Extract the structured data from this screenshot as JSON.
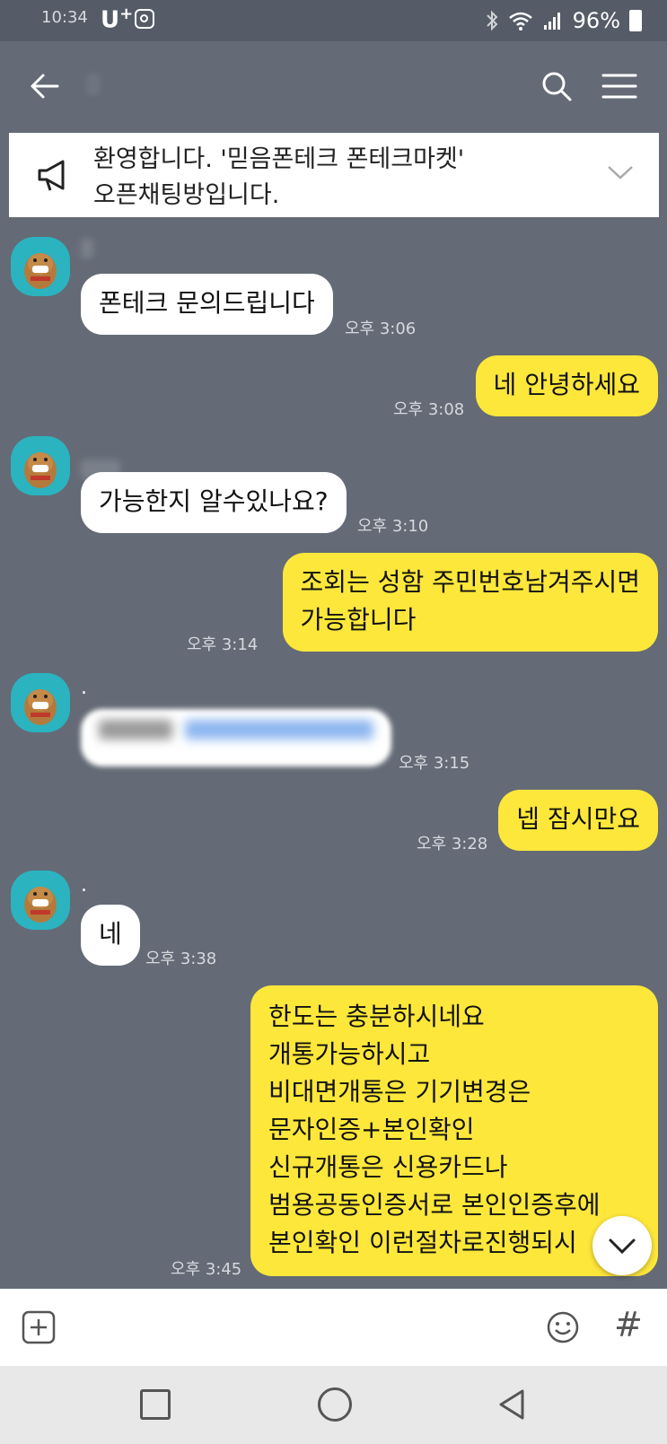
{
  "status_bar": {
    "time": "10:34",
    "carrier": "U",
    "carrier_sup": "+",
    "battery": "96%"
  },
  "notice": {
    "line1": "환영합니다. '믿음폰테크 폰테크마켓'",
    "line2": "오픈채팅방입니다."
  },
  "messages": [
    {
      "sender_visible": ".",
      "text": "폰테크 문의드립니다",
      "time": "오후 3:06"
    },
    {
      "text": "네 안녕하세요",
      "time": "오후 3:08"
    },
    {
      "text": "가능한지 알수있나요?",
      "time": "오후 3:10"
    },
    {
      "lines": [
        "조회는 성함 주민번호남겨주시면",
        "가능합니다"
      ],
      "time": "오후 3:14"
    },
    {
      "sender_visible": ".",
      "time": "오후 3:15"
    },
    {
      "text": "넵 잠시만요",
      "time": "오후 3:28"
    },
    {
      "sender_visible": ".",
      "text": "네",
      "time": "오후 3:38"
    },
    {
      "lines": [
        "한도는 충분하시네요",
        "개통가능하시고",
        "비대면개통은 기기변경은",
        "문자인증+본인확인",
        "신규개통은 신용카드나",
        "범용공동인증서로 본인인증후에",
        "본인확인  이런절차로진행되시"
      ],
      "time": "오후 3:45"
    }
  ],
  "input_bar": {
    "hashtag": "#"
  },
  "colors": {
    "chat_background": "#646b76",
    "outgoing_bubble": "#fde73a",
    "incoming_bubble": "#ffffff",
    "avatar_bg": "#2bb3c0"
  },
  "icons": [
    "back-icon",
    "search-icon",
    "menu-icon",
    "megaphone-icon",
    "chevron-down-icon",
    "plus-icon",
    "emoji-icon",
    "hash-icon"
  ]
}
